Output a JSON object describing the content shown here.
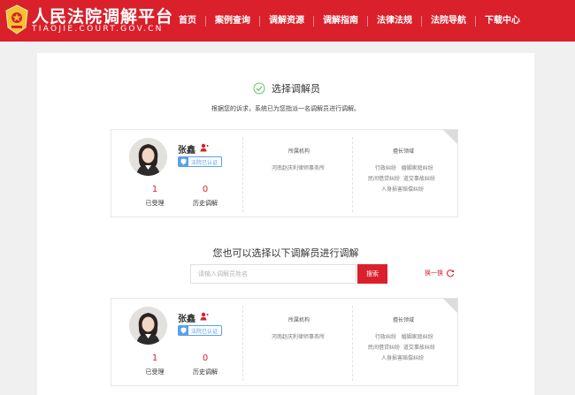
{
  "header": {
    "title": "人民法院调解平台",
    "subtitle": "TIAOJIE.COURT.GOV.CN",
    "nav": [
      "首页",
      "案例查询",
      "调解资源",
      "调解指南",
      "法律法规",
      "法院导航",
      "下载中心"
    ]
  },
  "selection": {
    "title": "选择调解员",
    "description": "根据您的诉求，系统已为您指派一名调解员进行调解。"
  },
  "mediators": [
    {
      "name": "张鑫",
      "badge": "法院已认证",
      "accepted_count": "1",
      "accepted_label": "已受理",
      "history_count": "0",
      "history_label": "历史调解",
      "org_header": "所属机构",
      "org": "河南赵庆利律师事务所",
      "areas_header": "擅长领域",
      "areas": [
        "行政纠纷",
        "婚姻家庭纠纷",
        "民间借贷纠纷",
        "道交事故纠纷",
        "人身损害赔偿纠纷"
      ]
    },
    {
      "name": "张鑫",
      "badge": "法院已认证",
      "accepted_count": "1",
      "accepted_label": "已受理",
      "history_count": "0",
      "history_label": "历史调解",
      "org_header": "所属机构",
      "org": "河南赵庆利律师事务所",
      "areas_header": "擅长领域",
      "areas": [
        "行政纠纷",
        "婚姻家庭纠纷",
        "民间借贷纠纷",
        "道交事故纠纷",
        "人身损害赔偿纠纷"
      ]
    }
  ],
  "alternative": {
    "title": "您也可以选择以下调解员进行调解",
    "search_placeholder": "请输入调解员姓名",
    "search_button": "搜索",
    "refresh_label": "换一换"
  },
  "colors": {
    "brand_red": "#d9202b",
    "badge_blue": "#5aa0e8",
    "success_green": "#6abf69"
  }
}
